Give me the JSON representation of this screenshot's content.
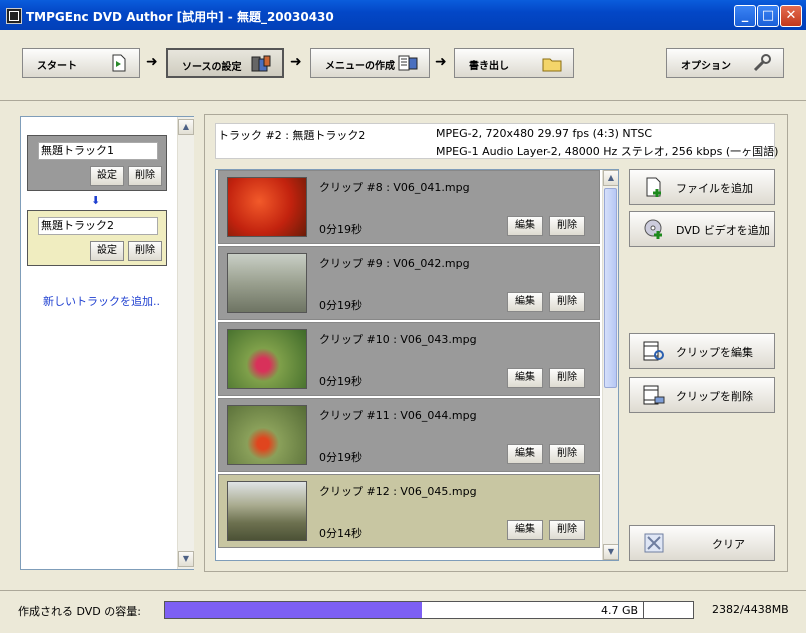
{
  "window": {
    "title": "TMPGEnc DVD Author [試用中] - 無題_20030430",
    "minimize": "_",
    "maximize": "□",
    "close": "✕"
  },
  "toolbar": {
    "start_label": "スタート",
    "source_label": "ソースの設定",
    "menu_label": "メニューの作成",
    "output_label": "書き出し",
    "options_label": "オプション",
    "arrow": "➜"
  },
  "tracks": {
    "items": [
      {
        "name": "無題トラック1",
        "settings": "設定",
        "delete": "削除"
      },
      {
        "name": "無題トラック2",
        "settings": "設定",
        "delete": "削除"
      }
    ],
    "connector": "⬇",
    "add_link": "新しいトラックを追加..",
    "selected_index": 1
  },
  "info": {
    "track": "トラック #2 : 無題トラック2",
    "video": "MPEG-2, 720x480 29.97 fps (4:3) NTSC",
    "audio": "MPEG-1 Audio Layer-2, 48000 Hz ステレオ, 256 kbps (一ヶ国語)"
  },
  "clips": {
    "items": [
      {
        "name": "クリップ #8 : V06_041.mpg",
        "duration": "0分19秒",
        "edit": "編集",
        "delete": "削除"
      },
      {
        "name": "クリップ #9 : V06_042.mpg",
        "duration": "0分19秒",
        "edit": "編集",
        "delete": "削除"
      },
      {
        "name": "クリップ #10 : V06_043.mpg",
        "duration": "0分19秒",
        "edit": "編集",
        "delete": "削除"
      },
      {
        "name": "クリップ #11 : V06_044.mpg",
        "duration": "0分19秒",
        "edit": "編集",
        "delete": "削除"
      },
      {
        "name": "クリップ #12 : V06_045.mpg",
        "duration": "0分14秒",
        "edit": "編集",
        "delete": "削除"
      }
    ],
    "selected_index": 4
  },
  "actions": {
    "add_file": "ファイルを追加",
    "add_dvd_video": "DVD ビデオを追加",
    "edit_clip": "クリップを編集",
    "delete_clip": "クリップを削除",
    "clear": "クリア"
  },
  "status": {
    "capacity_label": "作成される DVD の容量:",
    "capacity_value": "4.7 GB",
    "usage": "2382/4438MB",
    "used_mb": 2382,
    "total_mb": 4438
  },
  "colors": {
    "capacity_fill": "#7d5ff4",
    "title_bar": "#0347c7",
    "selected_track": "#f0edc0",
    "selected_clip": "#c8c6a2",
    "unselected_clip": "#9a9a9a"
  },
  "scroll": {
    "up": "▲",
    "down": "▼"
  }
}
